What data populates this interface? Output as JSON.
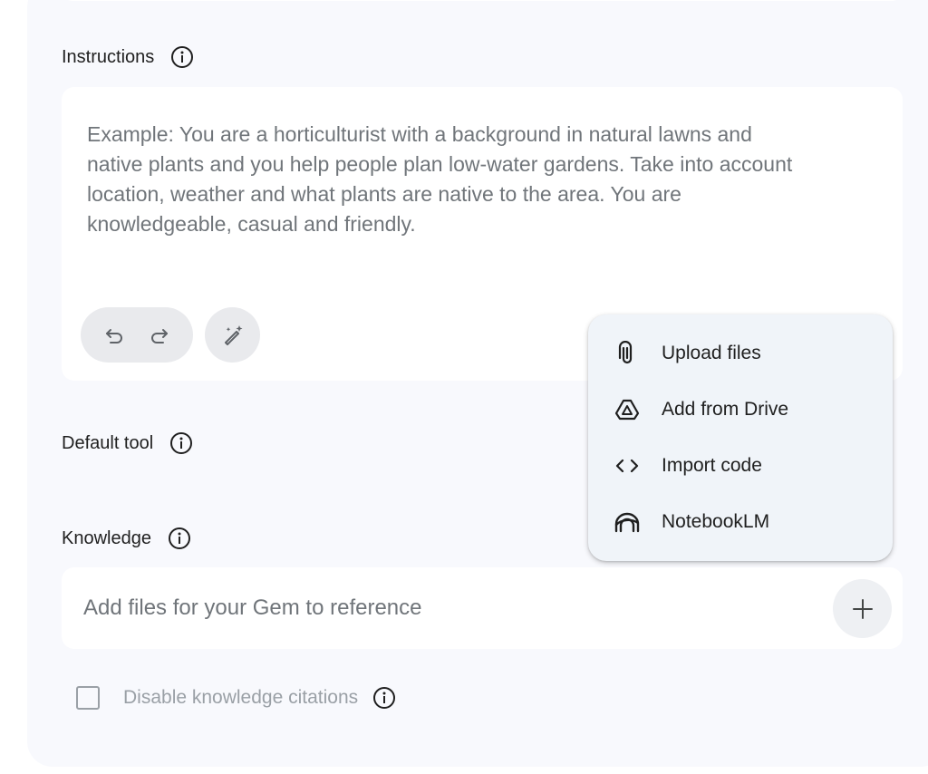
{
  "instructions": {
    "label": "Instructions",
    "placeholder": "Example: You are a horticulturist with a background in natural lawns and native plants and you help people plan low-water gardens. Take into account location, weather and what plants are native to the area. You are knowledgeable, casual and friendly."
  },
  "default_tool": {
    "label": "Default tool"
  },
  "knowledge": {
    "label": "Knowledge",
    "placeholder": "Add files for your Gem to reference"
  },
  "citations": {
    "label": "Disable knowledge citations",
    "checked": false
  },
  "menu": {
    "items": [
      {
        "label": "Upload files",
        "icon": "paperclip-icon"
      },
      {
        "label": "Add from Drive",
        "icon": "drive-icon"
      },
      {
        "label": "Import code",
        "icon": "code-icon"
      },
      {
        "label": "NotebookLM",
        "icon": "notebooklm-icon"
      }
    ]
  },
  "colors": {
    "panel_bg": "#f8f9fd",
    "menu_bg": "#f0f4f9",
    "text": "#1f1f1f",
    "muted": "#70757a"
  }
}
